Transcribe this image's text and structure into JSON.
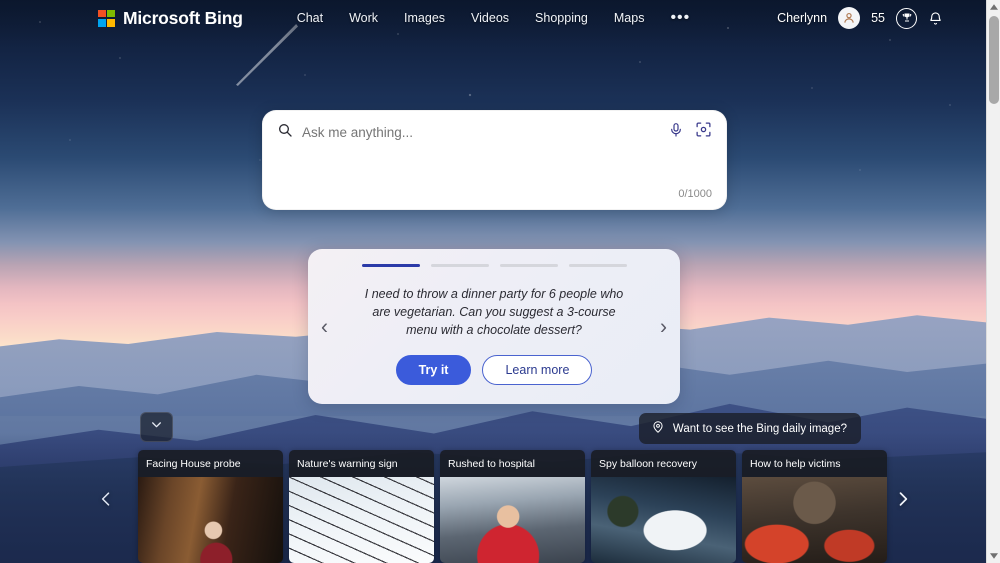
{
  "header": {
    "brand": "Microsoft Bing",
    "logo_colors": [
      "#f25022",
      "#7fba00",
      "#00a4ef",
      "#ffb900"
    ],
    "nav": [
      {
        "label": "Chat",
        "name": "nav-chat"
      },
      {
        "label": "Work",
        "name": "nav-work"
      },
      {
        "label": "Images",
        "name": "nav-images"
      },
      {
        "label": "Videos",
        "name": "nav-videos"
      },
      {
        "label": "Shopping",
        "name": "nav-shopping"
      },
      {
        "label": "Maps",
        "name": "nav-maps"
      }
    ],
    "more_label": "•••",
    "user_name": "Cherlynn",
    "rewards_points": "55",
    "icons": {
      "avatar": "person-avatar-icon",
      "rewards": "trophy-icon",
      "notifications": "bell-icon",
      "menu": "hamburger-menu-icon"
    }
  },
  "search": {
    "placeholder": "Ask me anything...",
    "value": "",
    "char_count": "0/1000",
    "search_icon": "search-icon",
    "mic_icon": "microphone-icon",
    "visual_icon": "visual-search-icon"
  },
  "suggestion_card": {
    "progress_total": 4,
    "progress_active_index": 0,
    "prompt": "I need to throw a dinner party for 6 people who are vegetarian. Can you suggest a 3-course menu with a chocolate dessert?",
    "primary_button": "Try it",
    "secondary_button": "Learn more",
    "prev_arrow": "‹",
    "next_arrow": "›",
    "accent_color": "#3b5bdb",
    "progress_active_color": "#2b3aa8"
  },
  "peek": {
    "expand_icon": "chevron-down-icon",
    "daily_image_label": "Want to see the Bing daily image?",
    "daily_image_icon": "location-pin-icon"
  },
  "news": {
    "prev_icon": "chevron-left-icon",
    "next_icon": "chevron-right-icon",
    "cards": [
      {
        "title": "Facing House probe",
        "thumb_class": "img-probe"
      },
      {
        "title": "Nature's warning sign",
        "thumb_class": "img-nature"
      },
      {
        "title": "Rushed to hospital",
        "thumb_class": "img-hospital"
      },
      {
        "title": "Spy balloon recovery",
        "thumb_class": "img-balloon"
      },
      {
        "title": "How to help victims",
        "thumb_class": "img-victims"
      }
    ]
  },
  "scrollbar": {
    "up_icon": "scroll-up-arrow-icon",
    "down_icon": "scroll-down-arrow-icon"
  }
}
